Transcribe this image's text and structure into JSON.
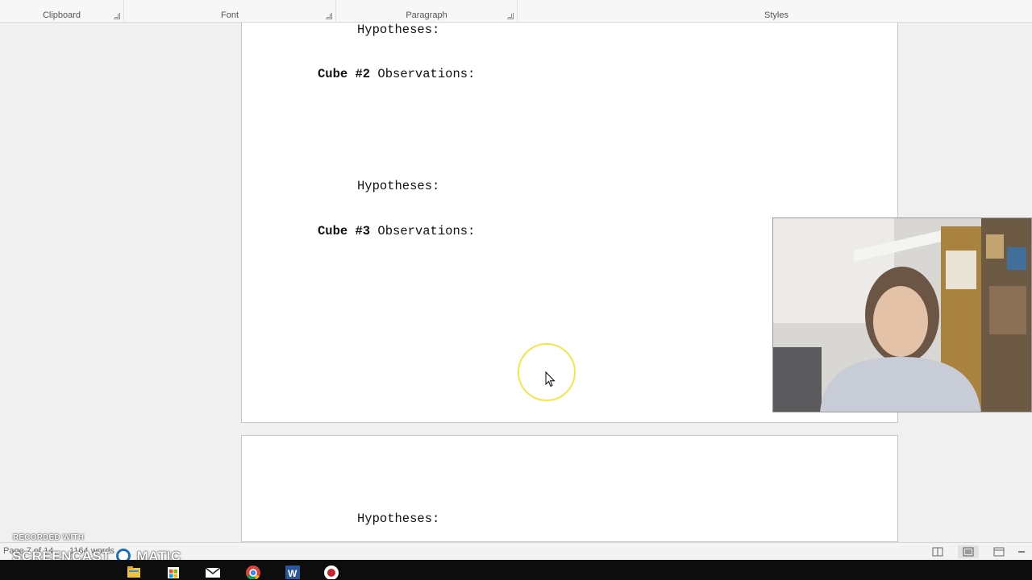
{
  "ribbon": {
    "groups": [
      {
        "label": "Clipboard"
      },
      {
        "label": "Font"
      },
      {
        "label": "Paragraph"
      },
      {
        "label": "Styles"
      }
    ]
  },
  "document": {
    "page1": {
      "hyp1": "Hypotheses:",
      "cube2_bold": "Cube #2",
      "cube2_rest": " Observations:",
      "hyp2": "Hypotheses:",
      "cube3_bold": "Cube #3",
      "cube3_rest": " Observations:"
    },
    "page2": {
      "hyp3": "Hypotheses:"
    }
  },
  "statusbar": {
    "page": "Page 7 of 14",
    "words": "1164 words"
  },
  "watermark": {
    "line1": "RECORDED WITH",
    "line2": "SCREENCAST",
    "line3": "MATIC"
  },
  "taskbar": {
    "icons": [
      "file-explorer-icon",
      "store-icon",
      "mail-icon",
      "chrome-icon",
      "word-icon",
      "screencast-record-icon"
    ]
  },
  "colors": {
    "cursor_ring": "#f2e64a",
    "word_blue": "#2b579a",
    "record_red": "#c0282d"
  }
}
